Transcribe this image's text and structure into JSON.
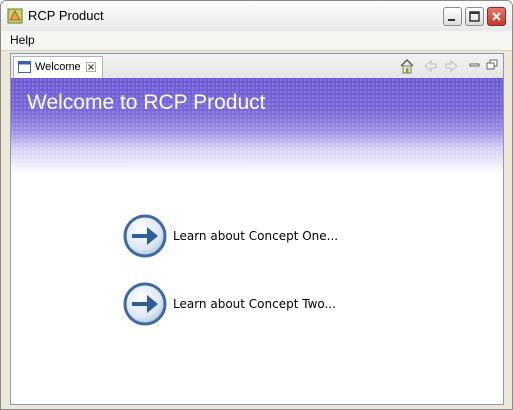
{
  "window": {
    "title": "RCP Product"
  },
  "menu": {
    "help_label": "Help"
  },
  "tab": {
    "label": "Welcome"
  },
  "banner": {
    "title": "Welcome to RCP Product"
  },
  "links": [
    {
      "label": "Learn about Concept One..."
    },
    {
      "label": "Learn about Concept Two..."
    }
  ],
  "colors": {
    "banner_purple": "#6b5ad6",
    "close_red": "#c23a2a",
    "arrow_blue": "#2f5f98"
  }
}
